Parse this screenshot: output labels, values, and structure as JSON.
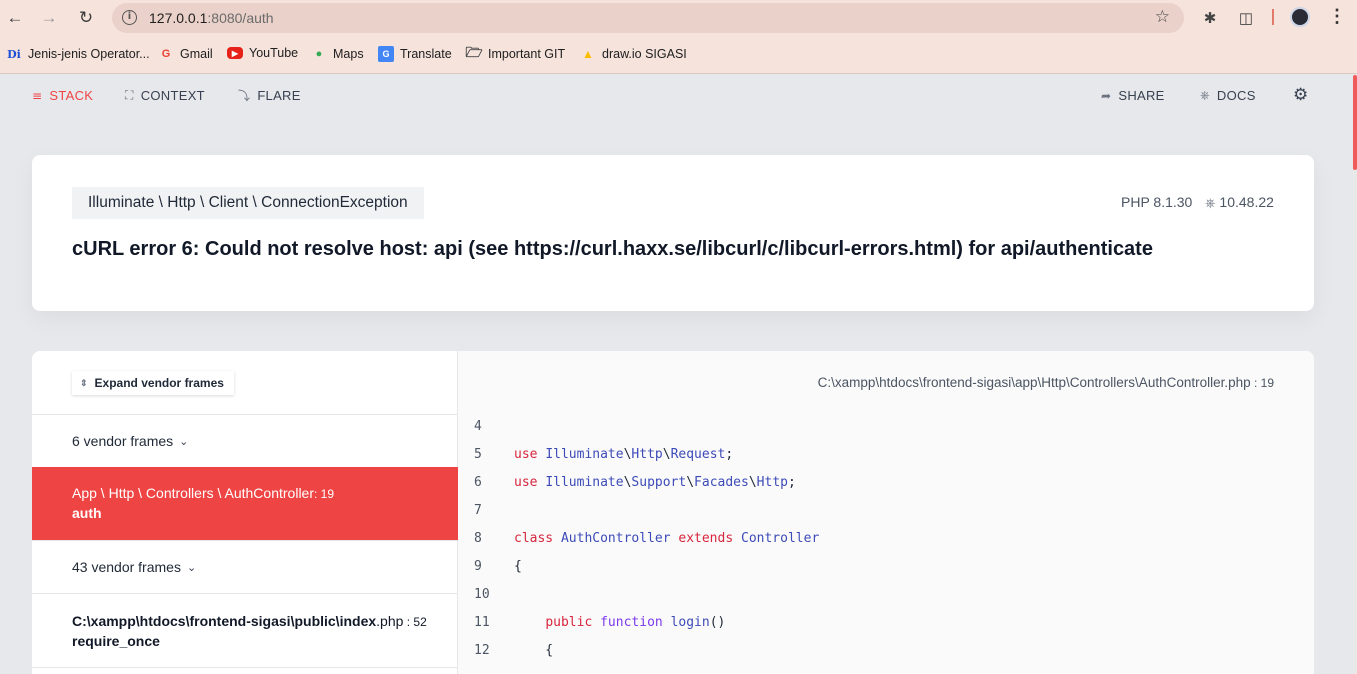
{
  "browser": {
    "url_host": "127.0.0.1",
    "url_rest": ":8080/auth",
    "bookmarks": [
      {
        "label": "Jenis-jenis Operator...",
        "icon": "di-icon"
      },
      {
        "label": "Gmail",
        "icon": "google-icon"
      },
      {
        "label": "YouTube",
        "icon": "youtube-icon"
      },
      {
        "label": "Maps",
        "icon": "maps-icon"
      },
      {
        "label": "Translate",
        "icon": "translate-icon"
      },
      {
        "label": "Important GIT",
        "icon": "folder-icon"
      },
      {
        "label": "draw.io SIGASI",
        "icon": "drive-icon"
      }
    ]
  },
  "topnav": {
    "stack": "STACK",
    "context": "CONTEXT",
    "flare": "FLARE",
    "share": "SHARE",
    "docs": "DOCS"
  },
  "exception": {
    "class": "Illuminate \\ Http \\ Client \\ ConnectionException",
    "message": "cURL error 6: Could not resolve host: api (see https://curl.haxx.se/libcurl/c/libcurl-errors.html) for api/authenticate",
    "php_version": "PHP 8.1.30",
    "laravel_version": "10.48.22"
  },
  "frames": {
    "expand_label": "Expand vendor frames",
    "vendor_group_1": "6 vendor frames",
    "active_class": "App \\ Http \\ Controllers \\ AuthController",
    "active_line": ": 19",
    "active_fn": "auth",
    "vendor_group_2": "43 vendor frames",
    "last_path": "C:\\xampp\\htdocs\\frontend-sigasi\\public\\index",
    "last_ext": ".php",
    "last_line": " : 52",
    "last_fn": "require_once"
  },
  "code": {
    "file_path": "C:\\xampp\\htdocs\\frontend-sigasi\\app\\Http\\Controllers\\AuthController",
    "file_ext": ".php",
    "file_line": " : 19",
    "lines": [
      {
        "num": "4",
        "text": ""
      },
      {
        "num": "5",
        "text": "use Illuminate\\Http\\Request;"
      },
      {
        "num": "6",
        "text": "use Illuminate\\Support\\Facades\\Http;"
      },
      {
        "num": "7",
        "text": ""
      },
      {
        "num": "8",
        "text": "class AuthController extends Controller"
      },
      {
        "num": "9",
        "text": "{"
      },
      {
        "num": "10",
        "text": ""
      },
      {
        "num": "11",
        "text": "    public function login()"
      },
      {
        "num": "12",
        "text": "    {"
      }
    ]
  },
  "colors": {
    "accent": "#ef4444",
    "keyword": "#d7263d",
    "namespace": "#3d4bb8"
  }
}
